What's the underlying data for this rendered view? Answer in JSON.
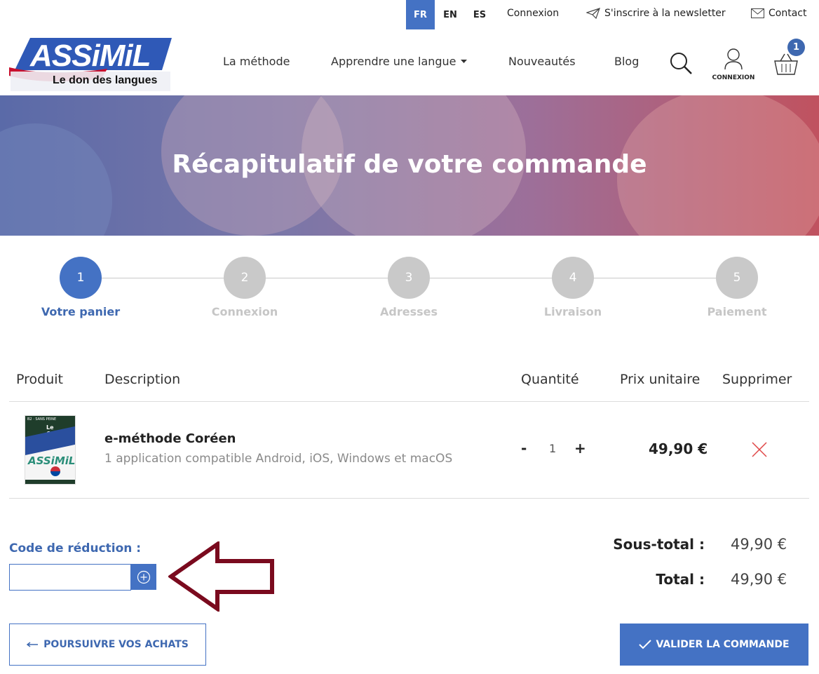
{
  "top_bar": {
    "languages": [
      "FR",
      "EN",
      "ES"
    ],
    "login": "Connexion",
    "newsletter": "S'inscrire à la newsletter",
    "contact": "Contact"
  },
  "logo": {
    "title": "ASSiMiL",
    "tagline": "Le don des langues"
  },
  "nav": {
    "method": "La méthode",
    "learn": "Apprendre une langue",
    "new": "Nouveautés",
    "blog": "Blog",
    "account_label": "CONNEXION",
    "cart_count": "1"
  },
  "hero": {
    "title": "Récapitulatif de votre commande"
  },
  "steps": [
    {
      "number": "1",
      "label": "Votre panier",
      "active": true
    },
    {
      "number": "2",
      "label": "Connexion",
      "active": false
    },
    {
      "number": "3",
      "label": "Adresses",
      "active": false
    },
    {
      "number": "4",
      "label": "Livraison",
      "active": false
    },
    {
      "number": "5",
      "label": "Paiement",
      "active": false
    }
  ],
  "table": {
    "headers": [
      "Produit",
      "Description",
      "Quantité",
      "Prix unitaire",
      "Supprimer"
    ],
    "rows": [
      {
        "book_cover_top": "Le Coréen",
        "book_cover_logo": "ASSiMiL",
        "name": "e-méthode Coréen",
        "description": "1 application compatible Android, iOS, Windows et macOS",
        "minus": "-",
        "quantity": "1",
        "plus": "+",
        "unit_price": "49,90 €"
      }
    ]
  },
  "coupon": {
    "label": "Code de réduction :"
  },
  "totals": {
    "subtotal_label": "Sous-total :",
    "subtotal": "49,90 €",
    "total_label": "Total :",
    "total": "49,90 €"
  },
  "actions": {
    "continue": "POURSUIVRE VOS ACHATS",
    "validate": "VALIDER LA COMMANDE"
  },
  "colors": {
    "accent": "#4472c4",
    "arrow_annotation": "#7a0a1e",
    "delete_icon": "#e04848"
  }
}
